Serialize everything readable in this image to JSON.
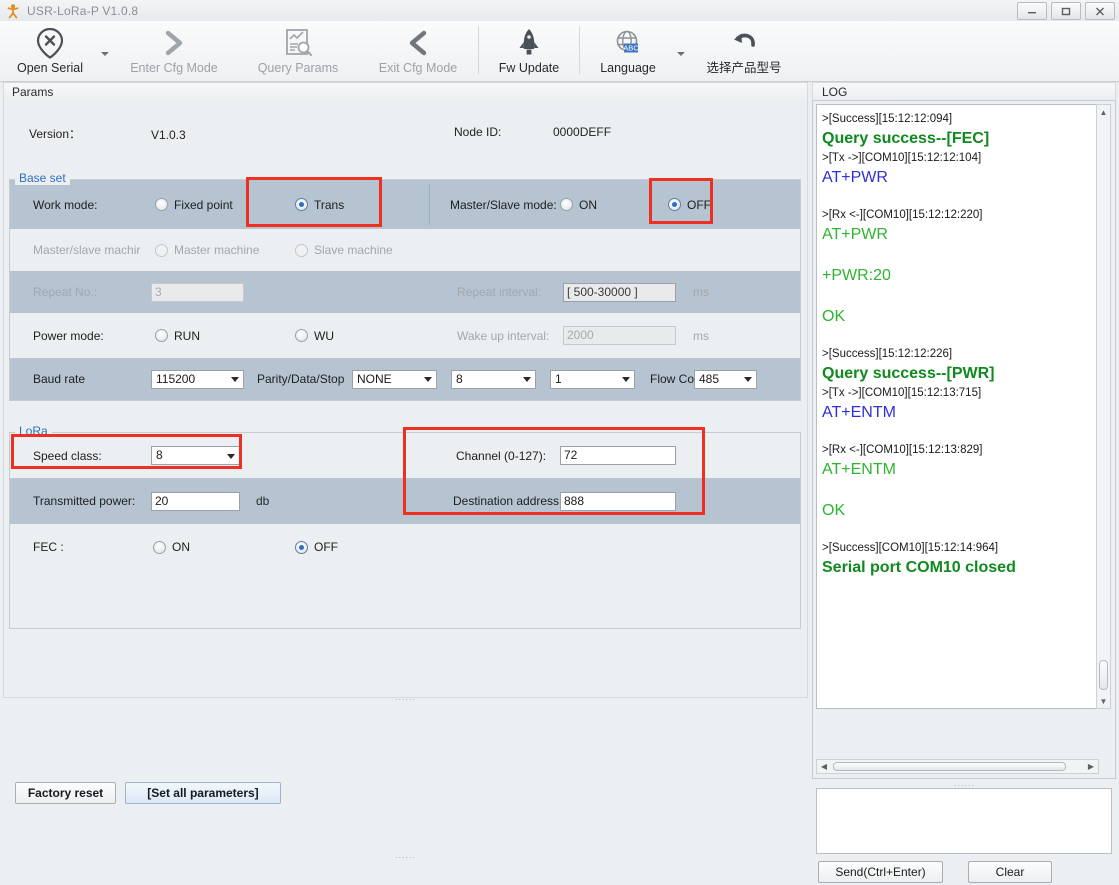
{
  "window": {
    "title": "USR-LoRa-P V1.0.8",
    "minimize": "–",
    "maximize": "❐",
    "close": "✕"
  },
  "toolbar": {
    "items": [
      {
        "label": "Open Serial",
        "icon": "open-serial-icon",
        "enabled": true,
        "caret": true
      },
      {
        "label": "Enter Cfg Mode",
        "icon": "chevron-right-icon",
        "enabled": false,
        "caret": false
      },
      {
        "label": "Query Params",
        "icon": "query-params-icon",
        "enabled": false,
        "caret": false
      },
      {
        "label": "Exit Cfg Mode",
        "icon": "chevron-left-icon",
        "enabled": false,
        "caret": false
      },
      {
        "label": "Fw Update",
        "icon": "rocket-icon",
        "enabled": true,
        "caret": false
      },
      {
        "label": "Language",
        "icon": "globe-abc-icon",
        "enabled": true,
        "caret": true
      },
      {
        "label": "选择产品型号",
        "icon": "undo-arrow-icon",
        "enabled": true,
        "caret": false
      }
    ]
  },
  "params": {
    "tab_label": "Params",
    "version_label": "Version：",
    "version_value": "V1.0.3",
    "nodeid_label": "Node ID:",
    "nodeid_value": "0000DEFF",
    "base_set": {
      "title": "Base set",
      "work_mode_label": "Work mode:",
      "work_mode_options": [
        "Fixed point",
        "Trans"
      ],
      "work_mode_selected": "Trans",
      "master_slave_mode_label": "Master/Slave mode:",
      "master_slave_mode_options": [
        "ON",
        "OFF"
      ],
      "master_slave_mode_selected": "OFF",
      "master_slave_machine_label": "Master/slave machir",
      "master_slave_machine_options": [
        "Master machine",
        "Slave machine"
      ],
      "repeat_no_label": "Repeat No.:",
      "repeat_no_value": "3",
      "repeat_interval_label": "Repeat interval:",
      "repeat_interval_value": "[ 500-30000 ]",
      "repeat_interval_unit": "ms",
      "power_mode_label": "Power mode:",
      "power_mode_options": [
        "RUN",
        "WU"
      ],
      "wake_up_label": "Wake up interval:",
      "wake_up_value": "2000",
      "wake_up_unit": "ms",
      "baud_rate_label": "Baud rate",
      "baud_rate_value": "115200",
      "parity_label": "Parity/Data/Stop",
      "parity_value": "NONE",
      "data_value": "8",
      "stop_value": "1",
      "flow_label": "Flow Con",
      "flow_value": "485"
    },
    "lora": {
      "title": "LoRa",
      "speed_class_label": "Speed class:",
      "speed_class_value": "8",
      "channel_label": "Channel (0-127):",
      "channel_value": "72",
      "transmitted_power_label": "Transmitted power:",
      "transmitted_power_value": "20",
      "transmitted_power_unit": "db",
      "destination_address_label": "Destination address",
      "destination_address_value": "888",
      "fec_label": "FEC :",
      "fec_options": [
        "ON",
        "OFF"
      ],
      "fec_selected": "OFF"
    },
    "buttons": {
      "factory_reset": "Factory reset",
      "set_all": "[Set all parameters]"
    }
  },
  "log": {
    "tab_label": "LOG",
    "entries": [
      {
        "meta": ">[Success][15:12:12:094]",
        "text": "Query success--[FEC]",
        "color": "#0f8a1e",
        "bold": true
      },
      {
        "meta": ">[Tx ->][COM10][15:12:12:104]",
        "text": "AT+PWR",
        "color": "#2f2fd8",
        "bold": false
      },
      {
        "meta": "",
        "text": "",
        "color": "",
        "bold": false
      },
      {
        "meta": ">[Rx <-][COM10][15:12:12:220]",
        "text": "AT+PWR",
        "color": "#2fb42f",
        "bold": false
      },
      {
        "meta": "",
        "text": "+PWR:20",
        "color": "#2fb42f",
        "bold": false
      },
      {
        "meta": "",
        "text": "OK",
        "color": "#2fb42f",
        "bold": false
      },
      {
        "meta": ">[Success][15:12:12:226]",
        "text": "Query success--[PWR]",
        "color": "#0f8a1e",
        "bold": true
      },
      {
        "meta": ">[Tx ->][COM10][15:12:13:715]",
        "text": "AT+ENTM",
        "color": "#2f2fd8",
        "bold": false
      },
      {
        "meta": "",
        "text": "",
        "color": "",
        "bold": false
      },
      {
        "meta": ">[Rx <-][COM10][15:12:13:829]",
        "text": "AT+ENTM",
        "color": "#2fb42f",
        "bold": false
      },
      {
        "meta": "",
        "text": "OK",
        "color": "#2fb42f",
        "bold": false
      },
      {
        "meta": ">[Success][COM10][15:12:14:964]",
        "text": "Serial port COM10 closed",
        "color": "#0f8a1e",
        "bold": true
      }
    ],
    "send_placeholder": "",
    "send_button": "Send(Ctrl+Enter)",
    "clear_button": "Clear"
  },
  "colors": {
    "highlight": "#ee2f22",
    "accent": "#2f6fbf",
    "row_alt": "#b6c3d1"
  }
}
